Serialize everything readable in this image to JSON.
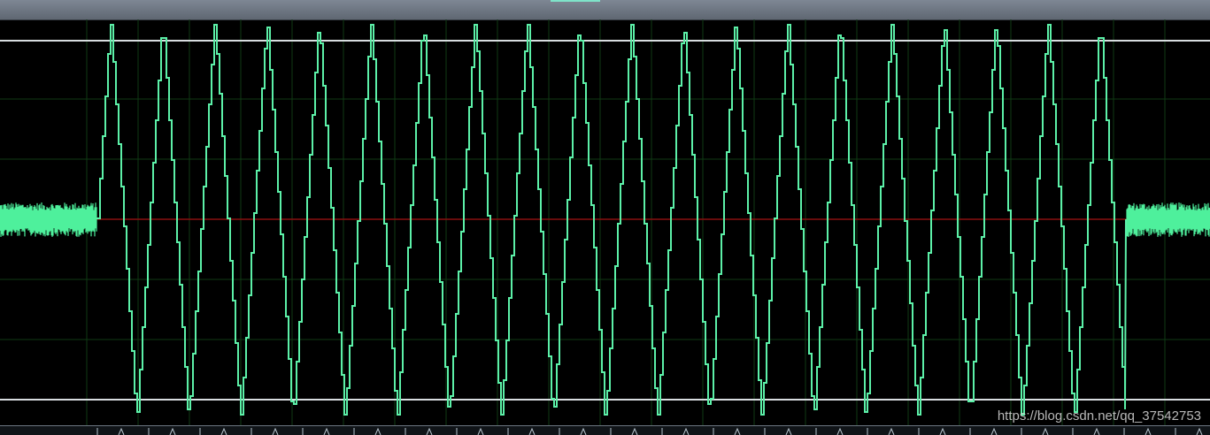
{
  "colors": {
    "background": "#000000",
    "grid": "#0f3a14",
    "waveform": "#5cf0a8",
    "noise": "#4ef09c",
    "center_line": "#8a1010",
    "limit_lines": "#d8dde0",
    "header": "#6b7380",
    "header_accent": "#7fe3c9",
    "ruler_marks": "#b9c6cf"
  },
  "waveform": {
    "cycles": 20,
    "burst_shape": "stepped-triangle",
    "leading_noise": true,
    "trailing_noise": true
  },
  "watermark": {
    "text": "https://blog.csdn.net/qq_37542753"
  }
}
